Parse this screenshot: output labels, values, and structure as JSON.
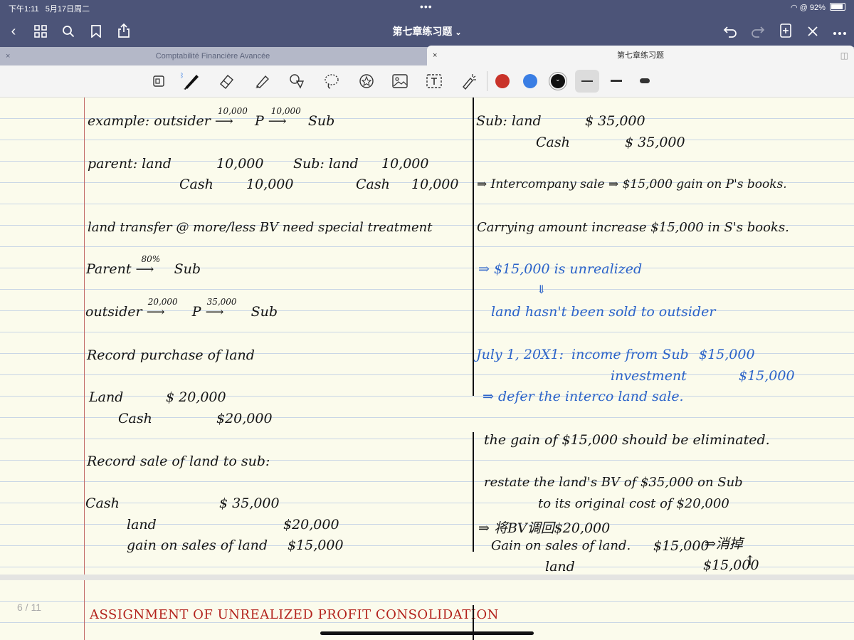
{
  "status": {
    "time": "下午1:11",
    "date": "5月17日周二",
    "dots": "•••",
    "battery": "92%"
  },
  "nav": {
    "title": "第七章练习题",
    "title_chevron": "⌄"
  },
  "tabs": [
    {
      "label": "Comptabilité Financière Avancée",
      "close": "×"
    },
    {
      "label": "第七章练习题",
      "close": "×"
    }
  ],
  "toolbar": {
    "colors": [
      "#c9332a",
      "#3a7ee4",
      "#111111"
    ],
    "tools": [
      "page-view-icon",
      "pen-icon",
      "eraser-icon",
      "highlighter-icon",
      "shapes-icon",
      "lasso-icon",
      "sticker-icon",
      "image-icon",
      "text-icon",
      "laser-pointer-icon"
    ]
  },
  "notes": {
    "left": {
      "l1_a": "example: outsider",
      "l1_b": "P",
      "l1_c": "Sub",
      "l1_o1": "10,000",
      "l1_o2": "10,000",
      "l2_a": "parent: land",
      "l2_b": "10,000",
      "l2_c": "Sub: land",
      "l2_d": "10,000",
      "l3_a": "Cash",
      "l3_b": "10,000",
      "l3_c": "Cash",
      "l3_d": "10,000",
      "l4": "land transfer @ more/less BV need special treatment",
      "l5_a": "Parent",
      "l5_o": "80%",
      "l5_b": "Sub",
      "l6_a": "outsider",
      "l6_o1": "20,000",
      "l6_b": "P",
      "l6_o2": "35,000",
      "l6_c": "Sub",
      "l7": "Record purchase of land",
      "l8_a": "Land",
      "l8_b": "$ 20,000",
      "l9_a": "Cash",
      "l9_b": "$20,000",
      "l10": "Record sale of land to sub:",
      "l11_a": "Cash",
      "l11_b": "$ 35,000",
      "l12_a": "land",
      "l12_b": "$20,000",
      "l13_a": "gain on sales of land",
      "l13_b": "$15,000"
    },
    "right": {
      "r1_a": "Sub: land",
      "r1_b": "$ 35,000",
      "r2_a": "Cash",
      "r2_b": "$ 35,000",
      "r3": "⇒ Intercompany sale ⇒ $15,000 gain on P's books.",
      "r4": "Carrying amount increase $15,000 in S's books.",
      "r5": "⇒ $15,000 is unrealized",
      "r6": "⇓",
      "r7": "land hasn't been sold to outsider",
      "r8_a": "July 1, 20X1:",
      "r8_b": "income from Sub",
      "r8_c": "$15,000",
      "r9_a": "investment",
      "r9_b": "$15,000",
      "r10": "⇒ defer the interco land sale.",
      "r11": "the gain of $15,000 should be eliminated.",
      "r12": "restate the land's BV of $35,000 on Sub",
      "r13": "to its original cost of $20,000",
      "r14": "⇒ 将BV调回$20,000",
      "r15_a": "Gain on sales of land.",
      "r15_b": "$15,000",
      "r15_c": "⇒消掉",
      "r16_a": "land",
      "r16_b": "$15,000",
      "r16_c": "↑"
    },
    "page2": {
      "heading": "ASSIGNMENT OF UNREALIZED PROFIT CONSOLIDATION",
      "page_indicator": "6 / 11"
    }
  }
}
